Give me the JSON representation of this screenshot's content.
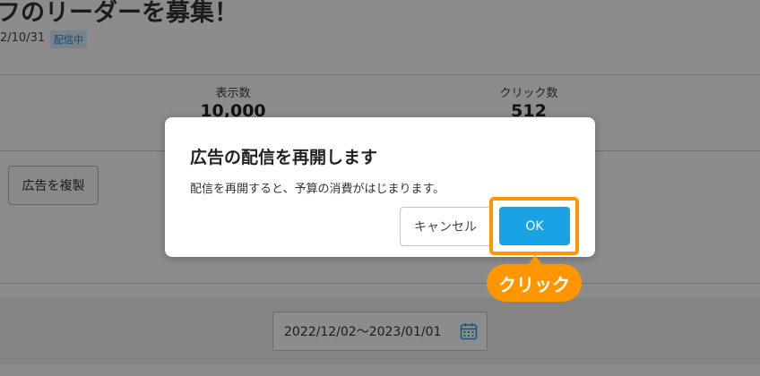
{
  "page": {
    "title": "フのリーダーを募集！",
    "date": "2/10/31",
    "status_badge": "配信中",
    "stats": {
      "impressions_label": "表示数",
      "impressions_value": "10,000",
      "clicks_label": "クリック数",
      "clicks_value": "512"
    },
    "duplicate_button": "広告を複製",
    "date_range": "2022/12/02〜2023/01/01"
  },
  "dialog": {
    "title": "広告の配信を再開します",
    "message": "配信を再開すると、予算の消費がはじまります。",
    "cancel_label": "キャンセル",
    "ok_label": "OK"
  },
  "annotation": {
    "callout": "クリック",
    "highlight_color": "#ff9500"
  },
  "colors": {
    "accent": "#1aa3e4",
    "badge_text": "#1a8fd1"
  },
  "icons": {
    "date_field": "calendar-icon"
  }
}
